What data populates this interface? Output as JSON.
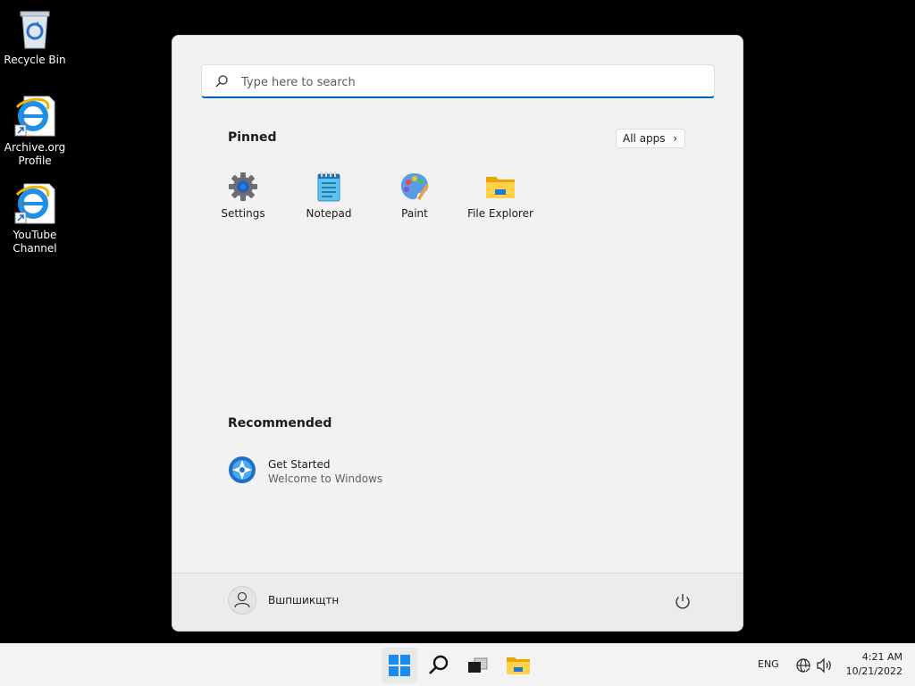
{
  "desktop": {
    "icons": [
      {
        "label": "Recycle Bin",
        "icon": "recycle-bin-icon"
      },
      {
        "label": "Archive.org Profile",
        "icon": "internet-explorer-icon"
      },
      {
        "label": "YouTube Channel",
        "icon": "internet-explorer-icon"
      }
    ]
  },
  "start_menu": {
    "search_placeholder": "Type here to search",
    "pinned_title": "Pinned",
    "all_apps_label": "All apps",
    "pinned_apps": [
      {
        "label": "Settings",
        "icon": "settings-gear-icon"
      },
      {
        "label": "Notepad",
        "icon": "notepad-icon"
      },
      {
        "label": "Paint",
        "icon": "paint-palette-icon"
      },
      {
        "label": "File Explorer",
        "icon": "folder-icon"
      }
    ],
    "recommended_title": "Recommended",
    "recommended": [
      {
        "title": "Get Started",
        "subtitle": "Welcome to Windows",
        "icon": "get-started-icon"
      }
    ],
    "user_name": "Вшпшикщтн"
  },
  "taskbar": {
    "items": [
      "windows-start-icon",
      "search-icon",
      "task-view-icon",
      "file-explorer-icon"
    ],
    "language": "ENG",
    "time": "4:21 AM",
    "date": "10/21/2022"
  },
  "colors": {
    "accent": "#005fb8",
    "desktop_bg": "#000000",
    "start_bg": "#f2f2f2"
  }
}
